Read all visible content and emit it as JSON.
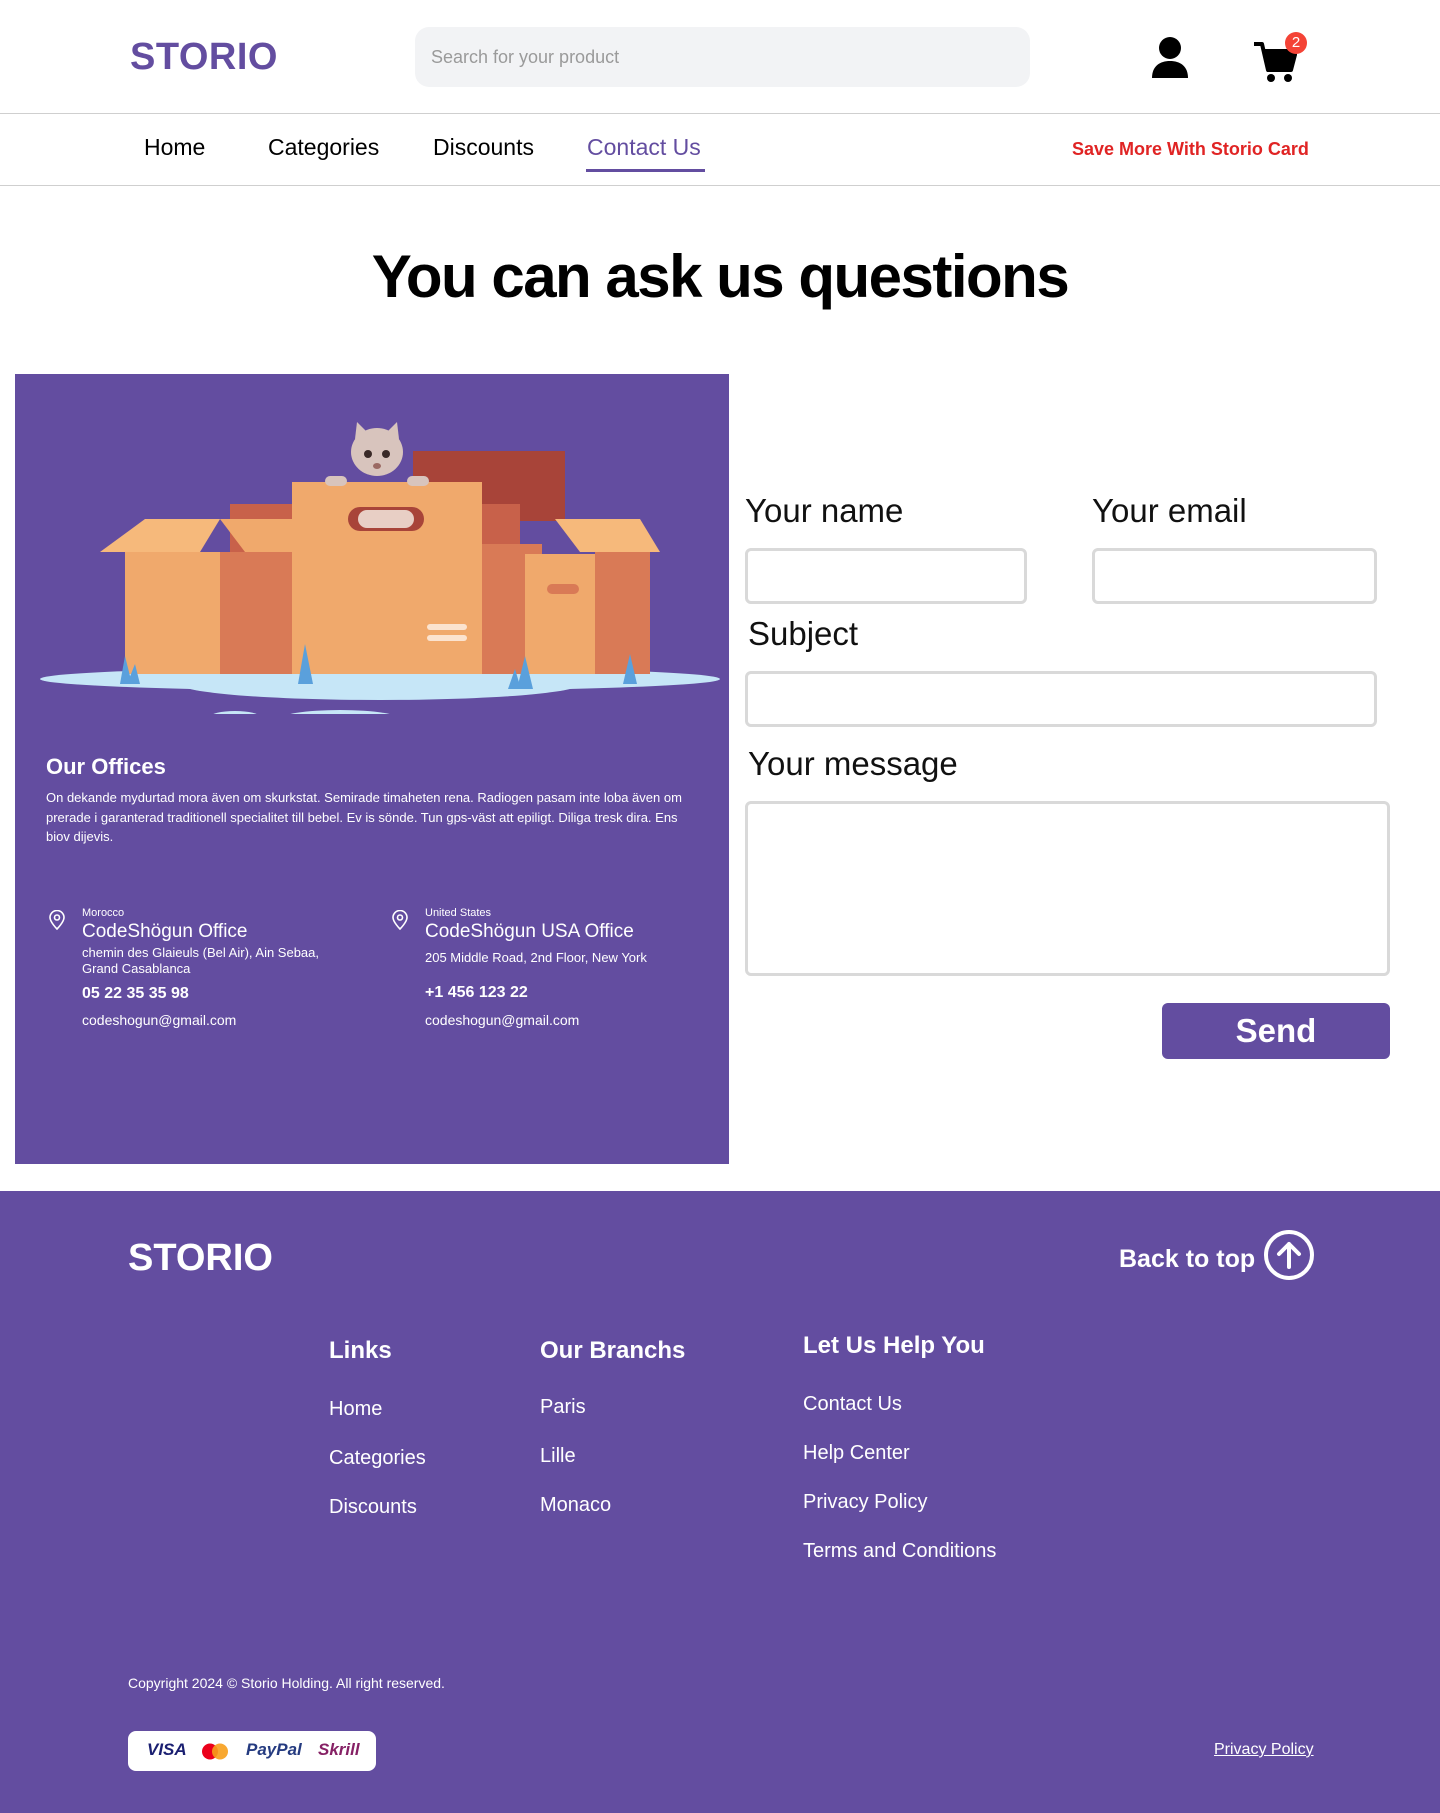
{
  "header": {
    "logo": "STORIO",
    "search_placeholder": "Search for your product",
    "cart_count": "2"
  },
  "nav": {
    "items": [
      "Home",
      "Categories",
      "Discounts",
      "Contact Us"
    ],
    "active": "Contact Us",
    "promo": "Save More With Storio Card"
  },
  "page_title": "You can ask us questions",
  "offices": {
    "title": "Our Offices",
    "description": "On dekande mydurtad mora även om skurkstat. Semirade timaheten rena. Radiogen pasam inte loba även om prerade i garanterad traditionell specialitet till bebel. Ev is sönde. Tun gps-väst att epiligt. Diliga tresk dira. Ens biov dijevis.",
    "list": [
      {
        "country": "Morocco",
        "name": "CodeShögun Office",
        "address": "chemin des Glaieuls (Bel Air), Ain Sebaa, Grand Casablanca",
        "phone": "05 22 35 35 98",
        "email": "codeshogun@gmail.com"
      },
      {
        "country": "United States",
        "name": "CodeShögun USA Office",
        "address": "205 Middle Road, 2nd Floor, New York",
        "phone": "+1 456 123 22",
        "email": "codeshogun@gmail.com"
      }
    ]
  },
  "form": {
    "name_label": "Your name",
    "email_label": "Your email",
    "subject_label": "Subject",
    "message_label": "Your message",
    "send_label": "Send"
  },
  "footer": {
    "logo": "STORIO",
    "back_to_top": "Back to top",
    "columns": [
      {
        "title": "Links",
        "items": [
          "Home",
          "Categories",
          "Discounts"
        ]
      },
      {
        "title": "Our Branchs",
        "items": [
          "Paris",
          "Lille",
          "Monaco"
        ]
      },
      {
        "title": "Let Us Help You",
        "items": [
          "Contact Us",
          "Help Center",
          "Privacy Policy",
          "Terms and Conditions"
        ]
      }
    ],
    "copyright": "Copyright 2024 © Storio Holding. All right reserved.",
    "payments": [
      "VISA",
      "PayPal",
      "Skrill"
    ],
    "privacy": "Privacy Policy"
  },
  "colors": {
    "brand": "#634da0",
    "promo": "#e02424",
    "badge": "#f44336"
  }
}
